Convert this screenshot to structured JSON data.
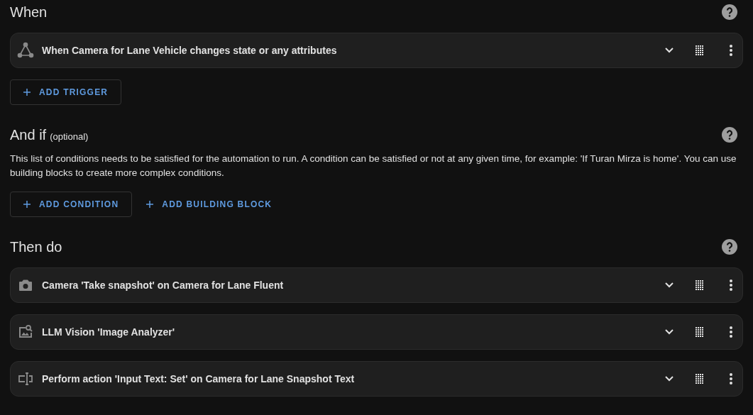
{
  "sections": [
    {
      "title": "When",
      "rows": [
        {
          "kind": "trigger",
          "text": "When Camera for Lane Vehicle changes state or any attributes"
        }
      ],
      "buttons": [
        {
          "kind": "outlined",
          "label": "ADD TRIGGER"
        }
      ]
    },
    {
      "title": "And if",
      "subtitle": "(optional)",
      "description": "This list of conditions needs to be satisfied for the automation to run. A condition can be satisfied or not at any given time, for example: 'If Turan Mirza is home'. You can use building blocks to create more complex conditions.",
      "buttons": [
        {
          "kind": "outlined",
          "label": "ADD CONDITION"
        },
        {
          "kind": "text",
          "label": "ADD BUILDING BLOCK"
        }
      ]
    },
    {
      "title": "Then do",
      "rows": [
        {
          "kind": "camera",
          "text": "Camera 'Take snapshot' on Camera for Lane Fluent"
        },
        {
          "kind": "image-search",
          "text": "LLM Vision 'Image Analyzer'"
        },
        {
          "kind": "text-input",
          "text": "Perform action 'Input Text: Set' on Camera for Lane Snapshot Text"
        }
      ]
    }
  ]
}
